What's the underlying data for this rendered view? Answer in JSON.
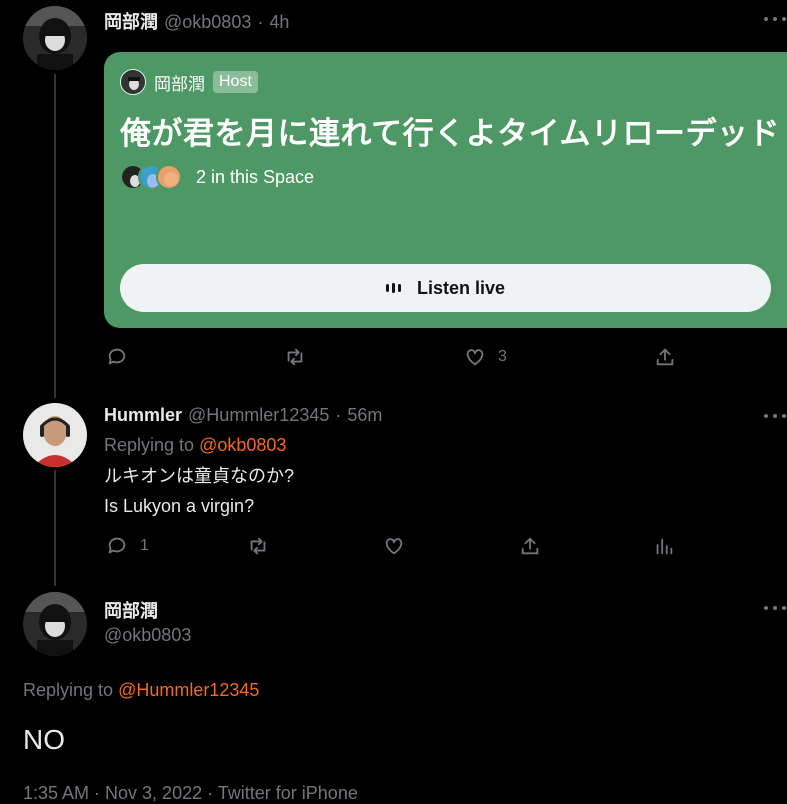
{
  "tweet1": {
    "name": "岡部潤",
    "handle": "@okb0803",
    "separator": "·",
    "time": "4h",
    "space": {
      "host_name": "岡部潤",
      "host_badge": "Host",
      "title": "俺が君を月に連れて行くよタイムリローデッド",
      "listeners": "2 in this Space",
      "listen_label": "Listen live",
      "card_color": "#4d9865"
    },
    "actions": {
      "reply_count": "",
      "retweet_count": "",
      "like_count": "3"
    }
  },
  "tweet2": {
    "name": "Hummler",
    "handle": "@Hummler12345",
    "separator": "·",
    "time": "56m",
    "replying_prefix": "Replying to",
    "replying_to": "@okb0803",
    "text_line1": "ルキオンは童貞なのか?",
    "text_line2": "Is Lukyon a virgin?",
    "actions": {
      "reply_count": "1"
    }
  },
  "main_tweet": {
    "name": "岡部潤",
    "handle": "@okb0803",
    "replying_prefix": "Replying to",
    "replying_to": "@Hummler12345",
    "text": "NO",
    "meta": "1:35 AM · Nov 3, 2022 · Twitter for iPhone"
  },
  "colors": {
    "mention": "#f26a1b",
    "muted": "#71767b",
    "background": "#000000"
  }
}
